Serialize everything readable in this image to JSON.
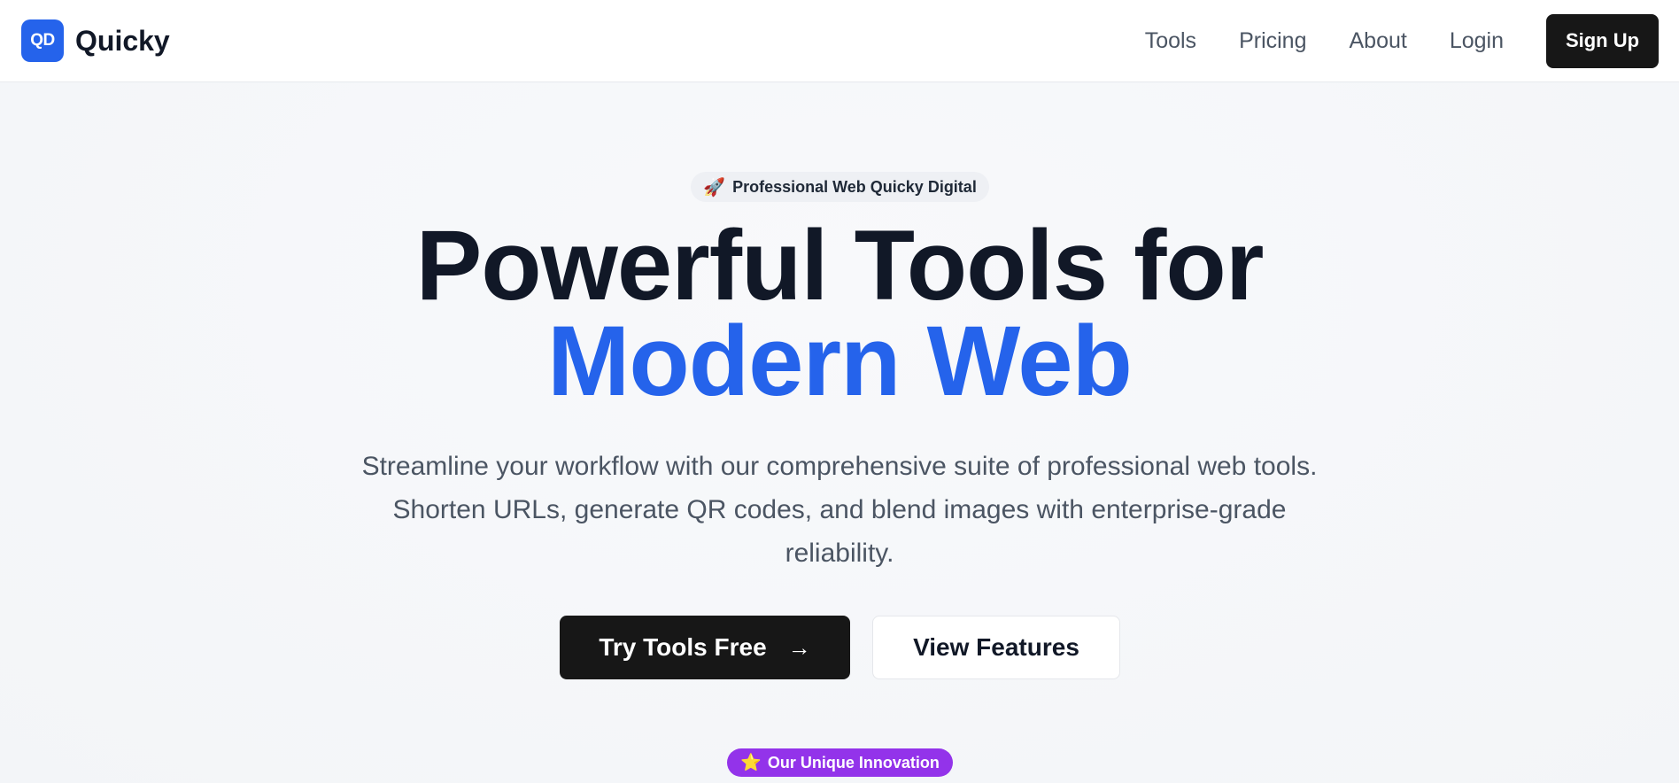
{
  "header": {
    "logo_text": "QD",
    "brand_name": "Quicky",
    "nav": [
      {
        "label": "Tools"
      },
      {
        "label": "Pricing"
      },
      {
        "label": "About"
      },
      {
        "label": "Login"
      }
    ],
    "signup_label": "Sign Up"
  },
  "hero": {
    "pill_icon": "🚀",
    "pill_text": "Professional Web Quicky Digital",
    "title_line1": "Powerful Tools for",
    "title_line2": "Modern Web",
    "subtitle": "Streamline your workflow with our comprehensive suite of professional web tools. Shorten URLs, generate QR codes, and blend images with enterprise-grade reliability.",
    "primary_cta": "Try Tools Free",
    "primary_cta_icon": "→",
    "secondary_cta": "View Features",
    "innovation_icon": "⭐",
    "innovation_text": "Our Unique Innovation"
  },
  "colors": {
    "accent": "#2563eb",
    "dark_button": "#171717",
    "badge_purple": "#9333ea"
  }
}
